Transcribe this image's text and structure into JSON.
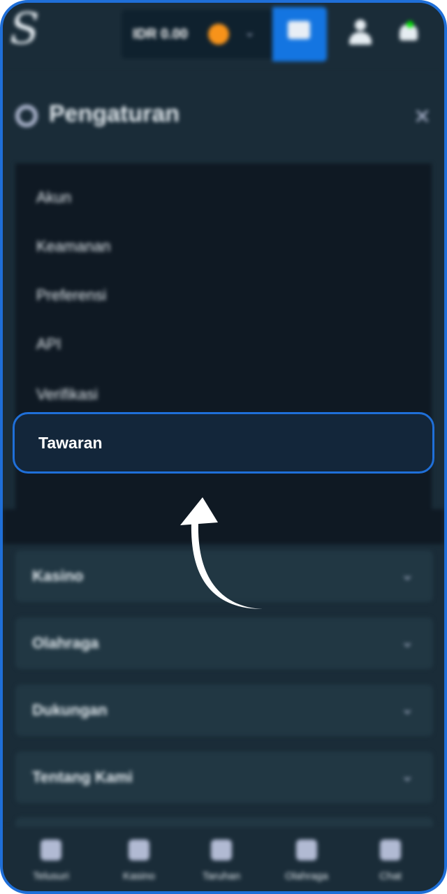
{
  "header": {
    "logo": "S",
    "balance": "IDR 0.00",
    "coin_icon": "bitcoin-coin-icon",
    "currency_chevron_icon": "chevron-down-icon",
    "wallet_icon": "wallet-icon",
    "user_icon": "user-icon",
    "notification_icon": "bell-icon"
  },
  "settings": {
    "title": "Pengaturan",
    "gear_icon": "gear-icon",
    "close_icon": "close-icon",
    "items": [
      {
        "label": "Akun"
      },
      {
        "label": "Keamanan"
      },
      {
        "label": "Preferensi"
      },
      {
        "label": "API"
      },
      {
        "label": "Verifikasi"
      },
      {
        "label": "Tawaran"
      }
    ],
    "highlighted_item": "Tawaran"
  },
  "accordions": [
    {
      "label": "Kasino"
    },
    {
      "label": "Olahraga"
    },
    {
      "label": "Dukungan"
    },
    {
      "label": "Tentang Kami"
    }
  ],
  "bottom_nav": [
    {
      "label": "Telusuri",
      "icon": "browse-icon"
    },
    {
      "label": "Kasino",
      "icon": "casino-icon"
    },
    {
      "label": "Taruhan",
      "icon": "bets-icon"
    },
    {
      "label": "Olahraga",
      "icon": "sports-icon"
    },
    {
      "label": "Chat",
      "icon": "chat-icon"
    }
  ],
  "colors": {
    "accent": "#1f6fd8",
    "background": "#1a2c38",
    "panel": "#0f1923"
  }
}
